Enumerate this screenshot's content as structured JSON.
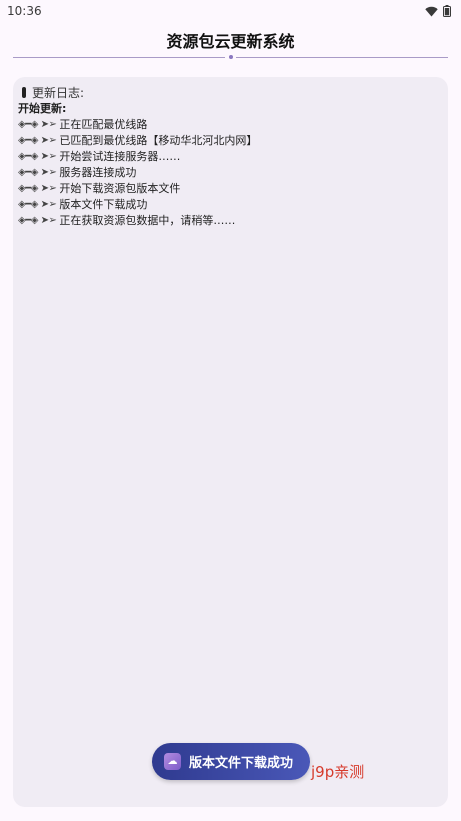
{
  "status_bar": {
    "time": "10:36",
    "icons": [
      "wifi-icon",
      "battery-icon"
    ]
  },
  "header": {
    "title": "资源包云更新系统"
  },
  "log": {
    "label": "更新日志:",
    "intro": "开始更新:",
    "prefix": "◈━◈ ➤➢",
    "lines": [
      "正在匹配最优线路",
      "已匹配到最优线路【移动华北河北内网】",
      "开始尝试连接服务器……",
      "服务器连接成功",
      "开始下载资源包版本文件",
      "版本文件下载成功",
      "正在获取资源包数据中，请稍等……"
    ]
  },
  "toast": {
    "message": "版本文件下载成功"
  },
  "watermark": {
    "text": "j9p亲测"
  },
  "colors": {
    "background": "#fdf8fe",
    "card": "#f0ecf4",
    "toast": "#3a469f",
    "watermark": "#d63a2b"
  }
}
